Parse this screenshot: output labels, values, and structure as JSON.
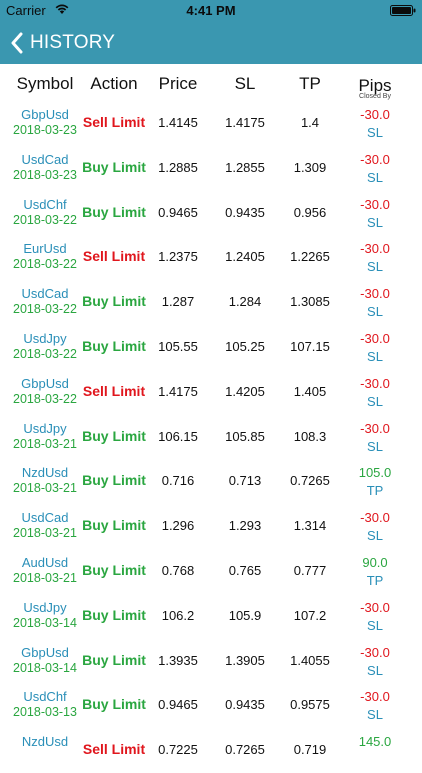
{
  "status": {
    "carrier": "Carrier",
    "time": "4:41 PM"
  },
  "nav": {
    "back_label": "HISTORY"
  },
  "header": {
    "symbol": "Symbol",
    "action": "Action",
    "price": "Price",
    "sl": "SL",
    "tp": "TP",
    "pips": "Pips",
    "closed_by": "Closed By"
  },
  "colors": {
    "nav": "#3a97b0",
    "sell": "#e0161d",
    "buy": "#2aa640",
    "symbol": "#2a8fb8"
  },
  "rows": [
    {
      "symbol": "GbpUsd",
      "date": "2018-03-23",
      "action": "Sell Limit",
      "price": "1.4145",
      "sl": "1.4175",
      "tp": "1.4",
      "pips": "-30.0",
      "closed": "SL"
    },
    {
      "symbol": "UsdCad",
      "date": "2018-03-23",
      "action": "Buy Limit",
      "price": "1.2885",
      "sl": "1.2855",
      "tp": "1.309",
      "pips": "-30.0",
      "closed": "SL"
    },
    {
      "symbol": "UsdChf",
      "date": "2018-03-22",
      "action": "Buy Limit",
      "price": "0.9465",
      "sl": "0.9435",
      "tp": "0.956",
      "pips": "-30.0",
      "closed": "SL"
    },
    {
      "symbol": "EurUsd",
      "date": "2018-03-22",
      "action": "Sell Limit",
      "price": "1.2375",
      "sl": "1.2405",
      "tp": "1.2265",
      "pips": "-30.0",
      "closed": "SL"
    },
    {
      "symbol": "UsdCad",
      "date": "2018-03-22",
      "action": "Buy Limit",
      "price": "1.287",
      "sl": "1.284",
      "tp": "1.3085",
      "pips": "-30.0",
      "closed": "SL"
    },
    {
      "symbol": "UsdJpy",
      "date": "2018-03-22",
      "action": "Buy Limit",
      "price": "105.55",
      "sl": "105.25",
      "tp": "107.15",
      "pips": "-30.0",
      "closed": "SL"
    },
    {
      "symbol": "GbpUsd",
      "date": "2018-03-22",
      "action": "Sell Limit",
      "price": "1.4175",
      "sl": "1.4205",
      "tp": "1.405",
      "pips": "-30.0",
      "closed": "SL"
    },
    {
      "symbol": "UsdJpy",
      "date": "2018-03-21",
      "action": "Buy Limit",
      "price": "106.15",
      "sl": "105.85",
      "tp": "108.3",
      "pips": "-30.0",
      "closed": "SL"
    },
    {
      "symbol": "NzdUsd",
      "date": "2018-03-21",
      "action": "Buy Limit",
      "price": "0.716",
      "sl": "0.713",
      "tp": "0.7265",
      "pips": "105.0",
      "closed": "TP"
    },
    {
      "symbol": "UsdCad",
      "date": "2018-03-21",
      "action": "Buy Limit",
      "price": "1.296",
      "sl": "1.293",
      "tp": "1.314",
      "pips": "-30.0",
      "closed": "SL"
    },
    {
      "symbol": "AudUsd",
      "date": "2018-03-21",
      "action": "Buy Limit",
      "price": "0.768",
      "sl": "0.765",
      "tp": "0.777",
      "pips": "90.0",
      "closed": "TP"
    },
    {
      "symbol": "UsdJpy",
      "date": "2018-03-14",
      "action": "Buy Limit",
      "price": "106.2",
      "sl": "105.9",
      "tp": "107.2",
      "pips": "-30.0",
      "closed": "SL"
    },
    {
      "symbol": "GbpUsd",
      "date": "2018-03-14",
      "action": "Buy Limit",
      "price": "1.3935",
      "sl": "1.3905",
      "tp": "1.4055",
      "pips": "-30.0",
      "closed": "SL"
    },
    {
      "symbol": "UsdChf",
      "date": "2018-03-13",
      "action": "Buy Limit",
      "price": "0.9465",
      "sl": "0.9435",
      "tp": "0.9575",
      "pips": "-30.0",
      "closed": "SL"
    },
    {
      "symbol": "NzdUsd",
      "date": "",
      "action": "Sell Limit",
      "price": "0.7225",
      "sl": "0.7265",
      "tp": "0.719",
      "pips": "145.0",
      "closed": ""
    }
  ]
}
